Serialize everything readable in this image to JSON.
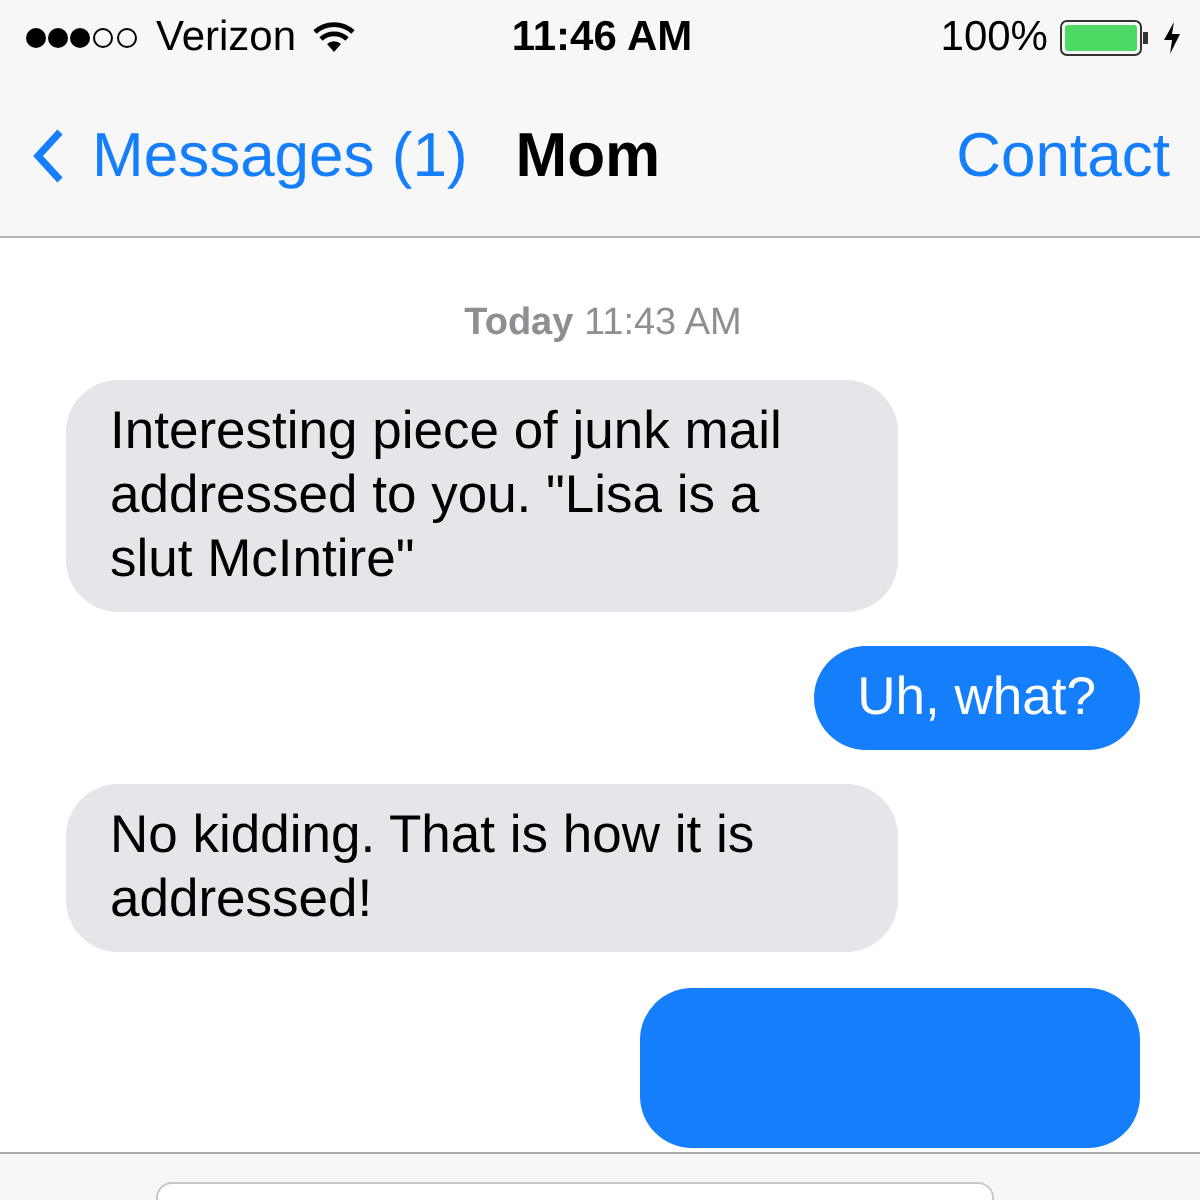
{
  "status_bar": {
    "carrier": "Verizon",
    "time": "11:46 AM",
    "battery": "100%"
  },
  "nav": {
    "back": "Messages (1)",
    "title": "Mom",
    "action": "Contact"
  },
  "timestamp": {
    "day": "Today",
    "time": "11:43 AM"
  },
  "messages": [
    {
      "kind": "received",
      "text": "Interesting piece of junk mail addressed to you. \"Lisa is a slut McIntire\""
    },
    {
      "kind": "sent",
      "text": "Uh, what?"
    },
    {
      "kind": "received",
      "text": "No kidding.  That is how it is addressed!"
    },
    {
      "kind": "sent"
    }
  ]
}
